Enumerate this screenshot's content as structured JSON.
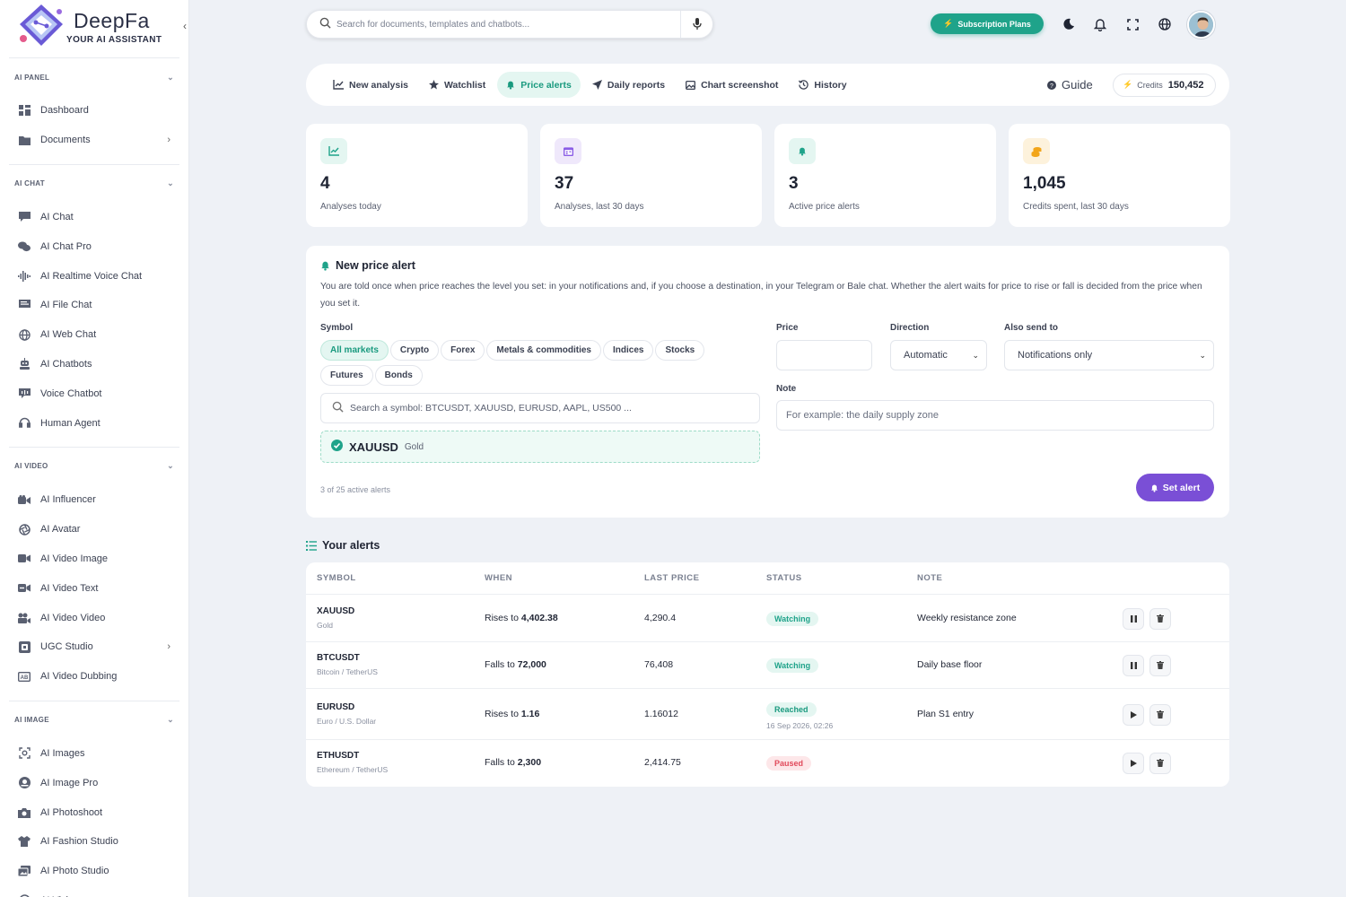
{
  "brand": {
    "name": "DeepFa",
    "tagline": "YOUR AI ASSISTANT"
  },
  "sidebar": {
    "sections": [
      {
        "title": "AI PANEL",
        "items": [
          {
            "label": "Dashboard",
            "icon": "dashboard-icon"
          },
          {
            "label": "Documents",
            "icon": "folder-icon",
            "has_arrow": true
          }
        ]
      },
      {
        "title": "AI CHAT",
        "items": [
          {
            "label": "AI Chat",
            "icon": "chat-icon"
          },
          {
            "label": "AI Chat Pro",
            "icon": "chats-icon"
          },
          {
            "label": "AI Realtime Voice Chat",
            "icon": "waveform-icon"
          },
          {
            "label": "AI File Chat",
            "icon": "file-chat-icon"
          },
          {
            "label": "AI Web Chat",
            "icon": "globe-icon"
          },
          {
            "label": "AI Chatbots",
            "icon": "robot-icon"
          },
          {
            "label": "Voice Chatbot",
            "icon": "voice-chatbot-icon"
          },
          {
            "label": "Human Agent",
            "icon": "headset-icon"
          }
        ]
      },
      {
        "title": "AI VIDEO",
        "items": [
          {
            "label": "AI Influencer",
            "icon": "video-camera-icon"
          },
          {
            "label": "AI Avatar",
            "icon": "aperture-icon"
          },
          {
            "label": "AI Video Image",
            "icon": "video-image-icon"
          },
          {
            "label": "AI Video Text",
            "icon": "video-text-icon"
          },
          {
            "label": "AI Video Video",
            "icon": "film-camera-icon"
          },
          {
            "label": "UGC Studio",
            "icon": "ugc-icon",
            "has_arrow": true
          },
          {
            "label": "AI Video Dubbing",
            "icon": "dubbing-icon"
          }
        ]
      },
      {
        "title": "AI IMAGE",
        "items": [
          {
            "label": "AI Images",
            "icon": "image-scan-icon"
          },
          {
            "label": "AI Image Pro",
            "icon": "camera-icon"
          },
          {
            "label": "AI Photoshoot",
            "icon": "photo-camera-icon"
          },
          {
            "label": "AI Fashion Studio",
            "icon": "shirt-icon"
          },
          {
            "label": "AI Photo Studio",
            "icon": "photo-gallery-icon"
          },
          {
            "label": "AI Vision",
            "icon": "vision-icon"
          }
        ]
      }
    ]
  },
  "topbar": {
    "search_placeholder": "Search for documents, templates and chatbots...",
    "subscription_label": "Subscription Plans"
  },
  "tabs": [
    {
      "label": "New analysis",
      "icon": "chart-line-icon"
    },
    {
      "label": "Watchlist",
      "icon": "star-icon"
    },
    {
      "label": "Price alerts",
      "icon": "bell-icon",
      "active": true
    },
    {
      "label": "Daily reports",
      "icon": "send-icon"
    },
    {
      "label": "Chart screenshot",
      "icon": "image-icon"
    },
    {
      "label": "History",
      "icon": "history-icon"
    }
  ],
  "guide_label": "Guide",
  "credits": {
    "label": "Credits",
    "value": "150,452"
  },
  "stats": [
    {
      "value": "4",
      "label": "Analyses today",
      "icon": "chart-line-icon",
      "color": "#1fa38a",
      "bg": "#e4f6f1"
    },
    {
      "value": "37",
      "label": "Analyses, last 30 days",
      "icon": "calendar-icon",
      "color": "#8a5ce6",
      "bg": "#efe8fb"
    },
    {
      "value": "3",
      "label": "Active price alerts",
      "icon": "bell-icon",
      "color": "#1fa38a",
      "bg": "#e4f6f1"
    },
    {
      "value": "1,045",
      "label": "Credits spent, last 30 days",
      "icon": "coins-icon",
      "color": "#f2a51a",
      "bg": "#fdf2dc"
    }
  ],
  "new_alert": {
    "title": "New price alert",
    "description": "You are told once when price reaches the level you set: in your notifications and, if you choose a destination, in your Telegram or Bale chat. Whether the alert waits for price to rise or fall is decided from the price when you set it.",
    "symbol_label": "Symbol",
    "markets": [
      {
        "label": "All markets",
        "active": true
      },
      {
        "label": "Crypto"
      },
      {
        "label": "Forex"
      },
      {
        "label": "Metals & commodities"
      },
      {
        "label": "Indices"
      },
      {
        "label": "Stocks"
      },
      {
        "label": "Futures"
      },
      {
        "label": "Bonds"
      }
    ],
    "symbol_search_placeholder": "Search a symbol: BTCUSDT, XAUUSD, EURUSD, AAPL, US500 ...",
    "selected_symbol": {
      "code": "XAUUSD",
      "name": "Gold"
    },
    "active_count": "3 of 25 active alerts",
    "price_label": "Price",
    "price_value": "",
    "direction_label": "Direction",
    "direction_value": "Automatic",
    "send_to_label": "Also send to",
    "send_to_value": "Notifications only",
    "note_label": "Note",
    "note_placeholder": "For example: the daily supply zone",
    "submit_label": "Set alert"
  },
  "alerts": {
    "title": "Your alerts",
    "columns": [
      "SYMBOL",
      "WHEN",
      "LAST PRICE",
      "STATUS",
      "NOTE"
    ],
    "rows": [
      {
        "symbol": "XAUUSD",
        "name": "Gold",
        "when_prefix": "Rises to",
        "when_value": "4,402.38",
        "last_price": "4,290.4",
        "status": "Watching",
        "status_type": "watching",
        "status_time": "",
        "note": "Weekly resistance zone",
        "action": "pause"
      },
      {
        "symbol": "BTCUSDT",
        "name": "Bitcoin / TetherUS",
        "when_prefix": "Falls to",
        "when_value": "72,000",
        "last_price": "76,408",
        "status": "Watching",
        "status_type": "watching",
        "status_time": "",
        "note": "Daily base floor",
        "action": "pause"
      },
      {
        "symbol": "EURUSD",
        "name": "Euro / U.S. Dollar",
        "when_prefix": "Rises to",
        "when_value": "1.16",
        "last_price": "1.16012",
        "status": "Reached",
        "status_type": "reached",
        "status_time": "16 Sep 2026, 02:26",
        "note": "Plan S1 entry",
        "action": "play"
      },
      {
        "symbol": "ETHUSDT",
        "name": "Ethereum / TetherUS",
        "when_prefix": "Falls to",
        "when_value": "2,300",
        "last_price": "2,414.75",
        "status": "Paused",
        "status_type": "paused",
        "status_time": "",
        "note": "",
        "action": "play"
      }
    ]
  }
}
